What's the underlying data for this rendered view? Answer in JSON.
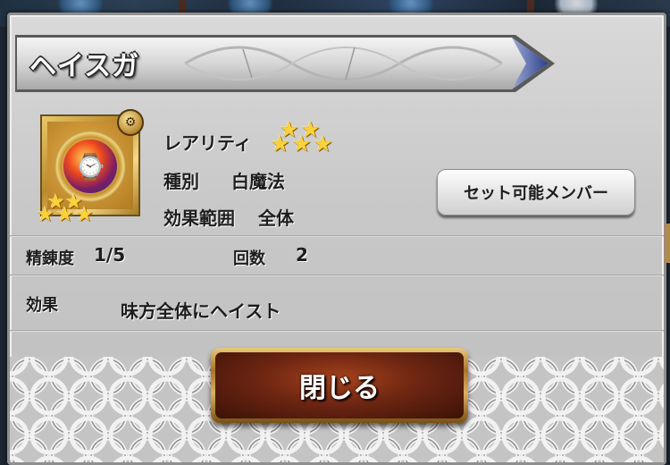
{
  "dialog": {
    "title": "ヘイスガ",
    "ability_icon": "haste-clock-orb-icon",
    "ability_stars": 3,
    "rarity": {
      "label": "レアリティ",
      "stars": 5
    },
    "type": {
      "label": "種別",
      "value": "白魔法"
    },
    "range": {
      "label": "効果範囲",
      "value": "全体"
    },
    "refine": {
      "label": "精錬度",
      "value": "1/5"
    },
    "uses": {
      "label": "回数",
      "value": "2"
    },
    "effect": {
      "label": "効果",
      "value": "味方全体にヘイスト"
    },
    "set_member_button": "セット可能メンバー",
    "close_button": "閉じる"
  },
  "colors": {
    "panel": "#cfcfcf",
    "close_button": "#6e2612",
    "gold_trim": "#d9b063",
    "star": "#ffd23a"
  }
}
